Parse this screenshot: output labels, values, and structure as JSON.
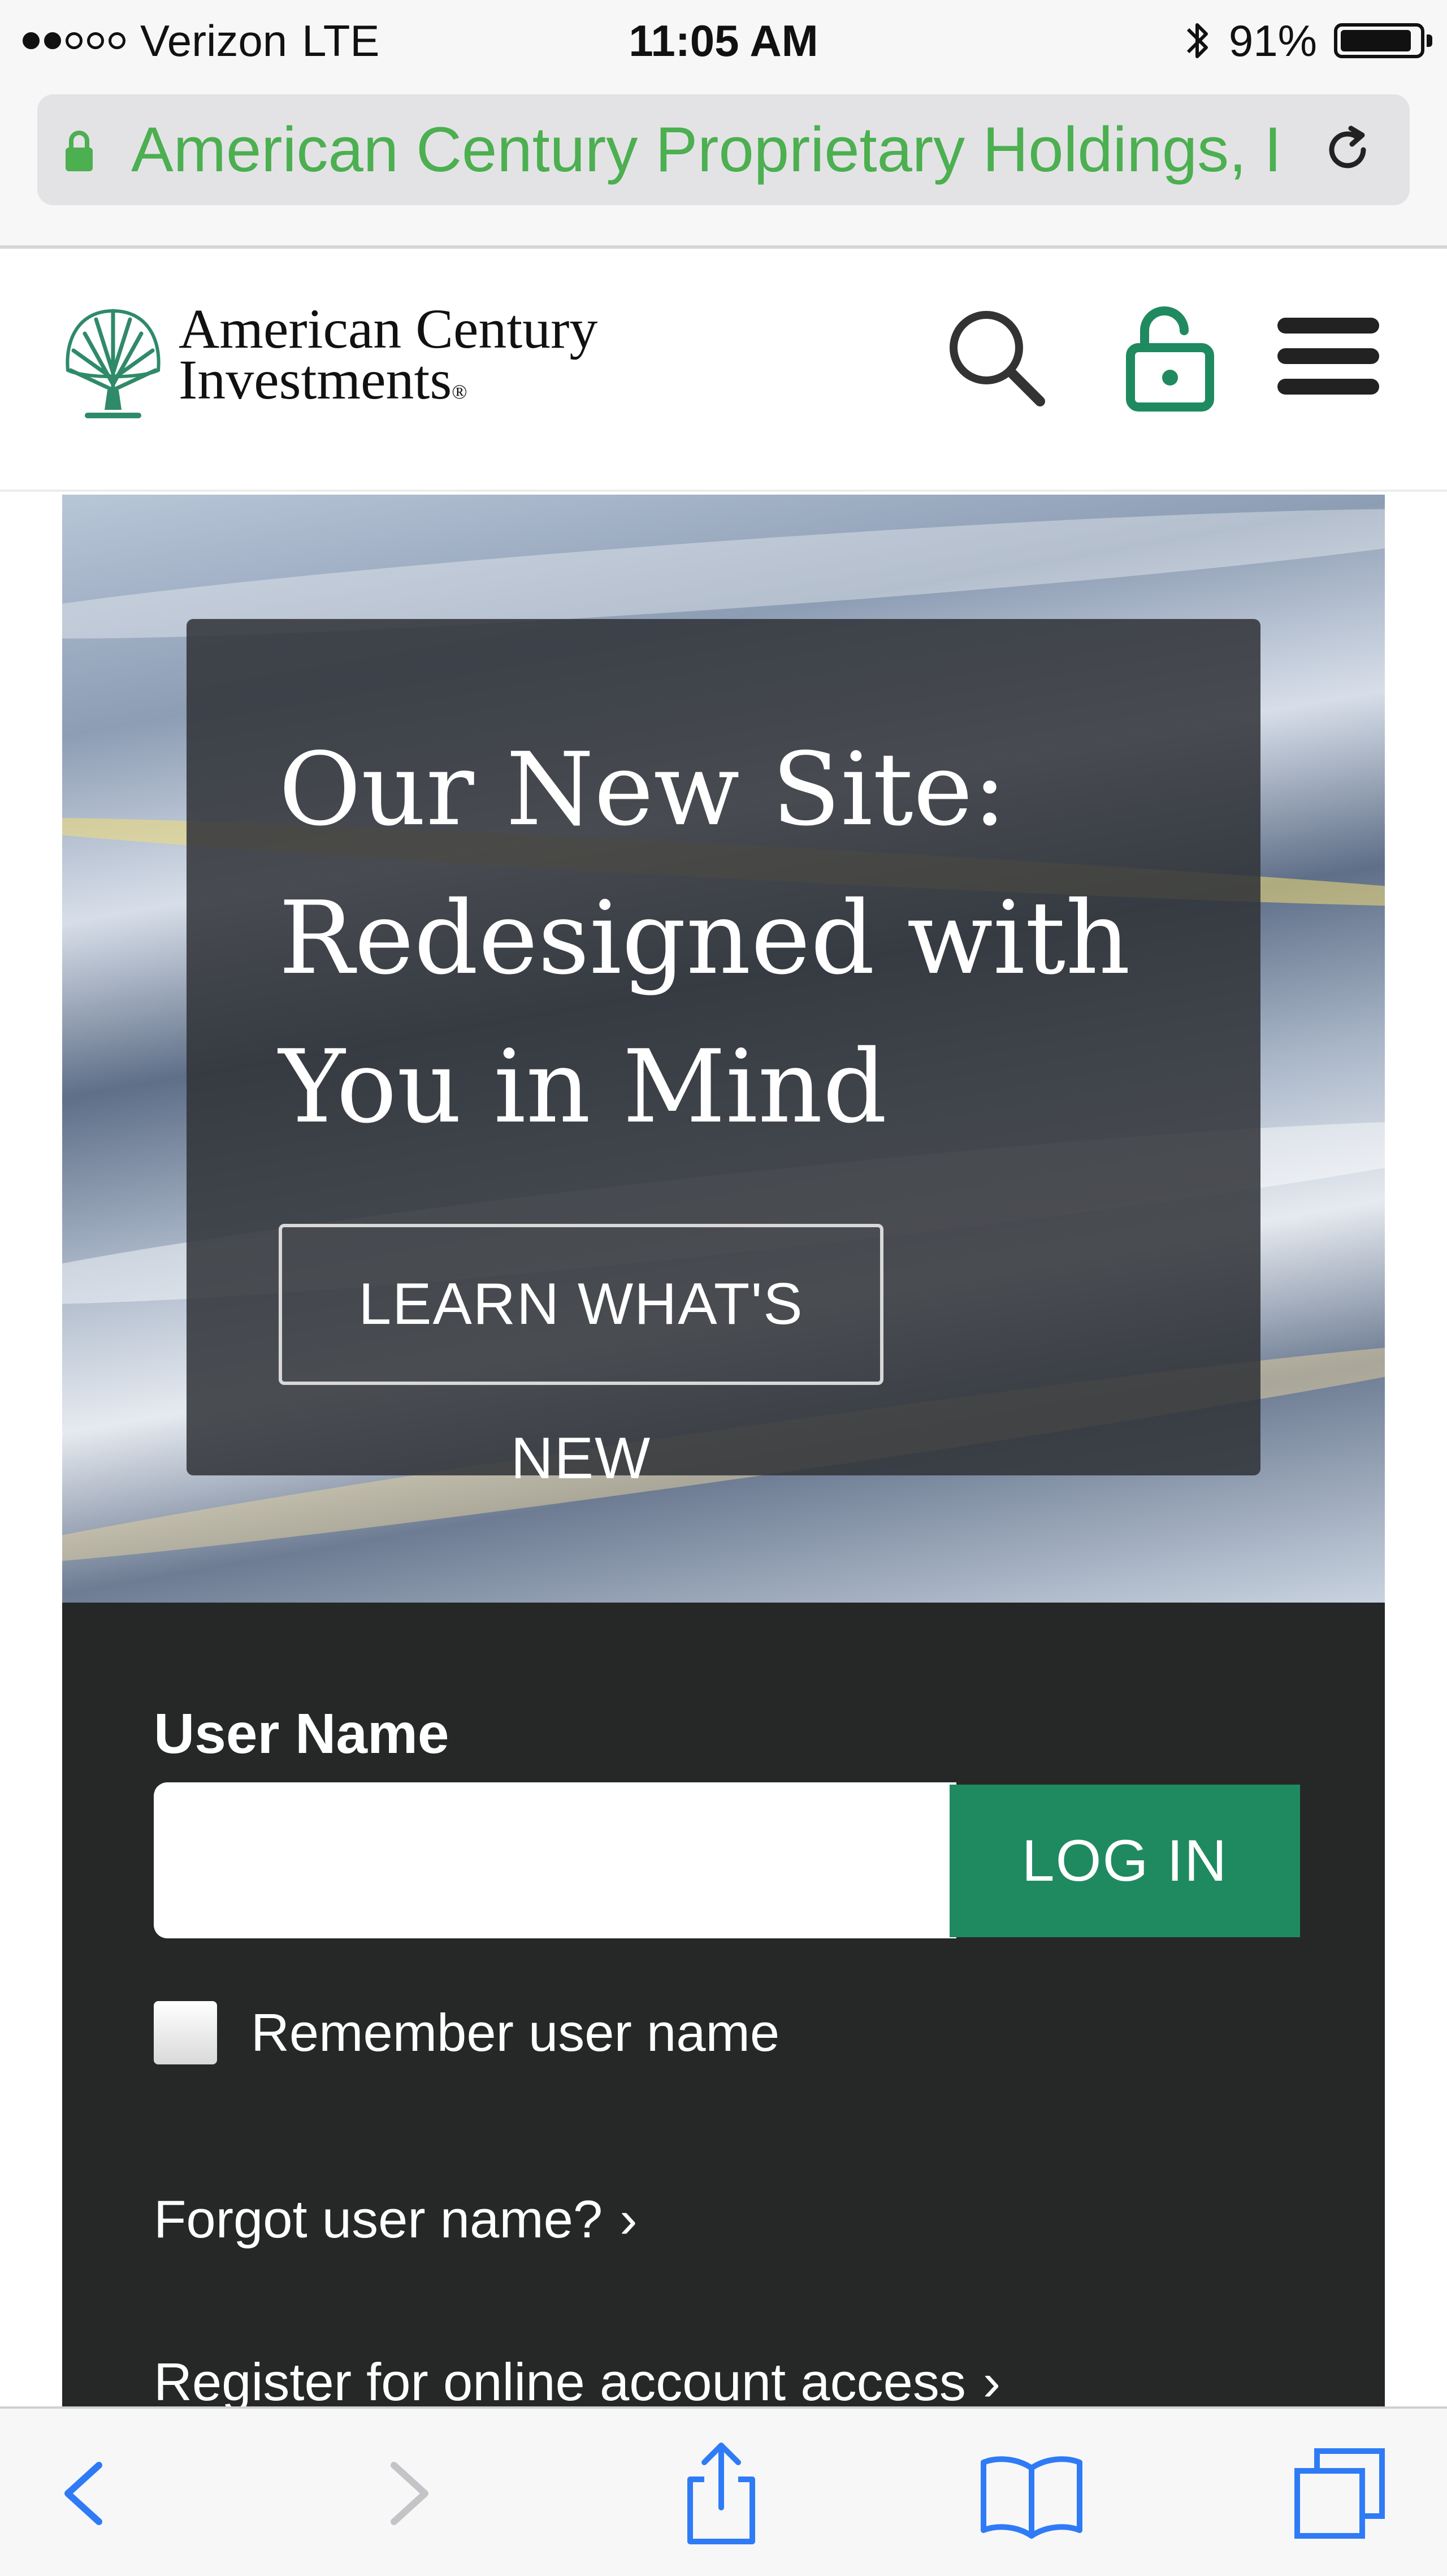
{
  "status_bar": {
    "carrier": "Verizon",
    "network": "LTE",
    "time": "11:05 AM",
    "battery": "91%",
    "battery_level": 0.91,
    "signal_bars": 2,
    "signal_total": 5
  },
  "browser": {
    "url_title": "American Century Proprietary Holdings, Inc. (US)"
  },
  "header": {
    "logo_line1": "American Century",
    "logo_line2": "Investments",
    "logo_reg": "®"
  },
  "hero": {
    "title": "Our New Site: Redesigned with You in Mind",
    "button_label": "LEARN WHAT'S NEW"
  },
  "login": {
    "username_label": "User Name",
    "username_value": "",
    "login_button": "LOG IN",
    "remember_label": "Remember user name",
    "remember_checked": false,
    "forgot_link": "Forgot user name?",
    "register_link": "Register for online account access"
  },
  "colors": {
    "brand_green": "#1f8a5f",
    "url_green": "#4caf50",
    "ios_blue": "#2f7bf6",
    "panel_dark": "#262828"
  }
}
